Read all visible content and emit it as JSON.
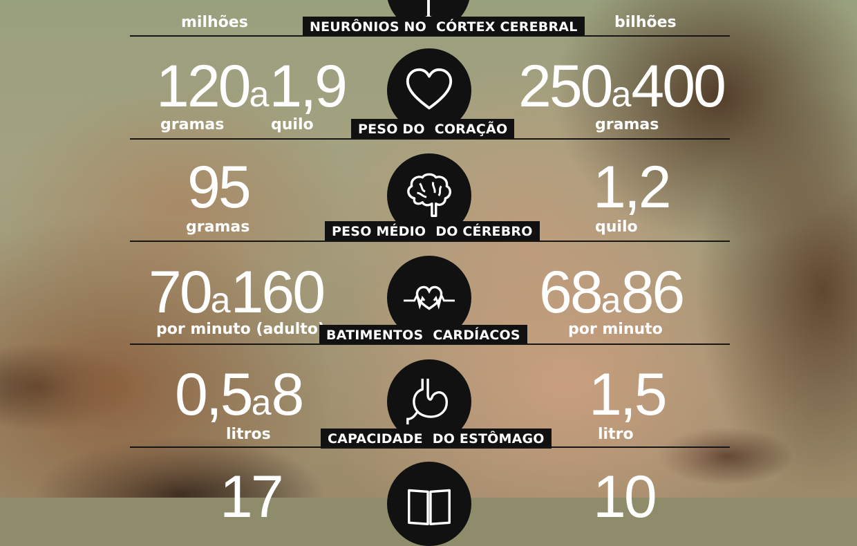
{
  "rows": [
    {
      "left_value": "",
      "left_unit": "milhões",
      "label_a": "NEURÔNIOS NO",
      "label_b": "CÓRTEX CEREBRAL",
      "right_value": "",
      "right_unit": "bilhões",
      "icon": "neuron-icon"
    },
    {
      "left_value_a": "120",
      "left_conn": "a",
      "left_value_b": "1,9",
      "left_unit_a": "gramas",
      "left_unit_b": "quilo",
      "label_a": "PESO DO",
      "label_b": "CORAÇÃO",
      "right_value_a": "250",
      "right_conn": "a",
      "right_value_b": "400",
      "right_unit": "gramas",
      "icon": "heart-icon"
    },
    {
      "left_value": "95",
      "left_unit": "gramas",
      "label_a": "PESO MÉDIO",
      "label_b": "DO CÉREBRO",
      "right_value": "1,2",
      "right_unit": "quilo",
      "icon": "brain-icon"
    },
    {
      "left_value_a": "70",
      "left_conn": "a",
      "left_value_b": "160",
      "left_unit": "por minuto (adulto)",
      "label_a": "BATIMENTOS",
      "label_b": "CARDÍACOS",
      "right_value_a": "68",
      "right_conn": "a",
      "right_value_b": "86",
      "right_unit": "por minuto",
      "icon": "heartbeat-icon"
    },
    {
      "left_value_a": "0,5",
      "left_conn": "a",
      "left_value_b": "8",
      "left_unit": "litros",
      "label_a": "CAPACIDADE",
      "label_b": "DO ESTÔMAGO",
      "right_value": "1,5",
      "right_unit": "litro",
      "icon": "stomach-icon"
    },
    {
      "left_value": "17",
      "right_value": "10",
      "icon": "book-icon"
    }
  ],
  "colors": {
    "text": "#ffffff",
    "badge": "#111111",
    "rule": "#151515"
  }
}
